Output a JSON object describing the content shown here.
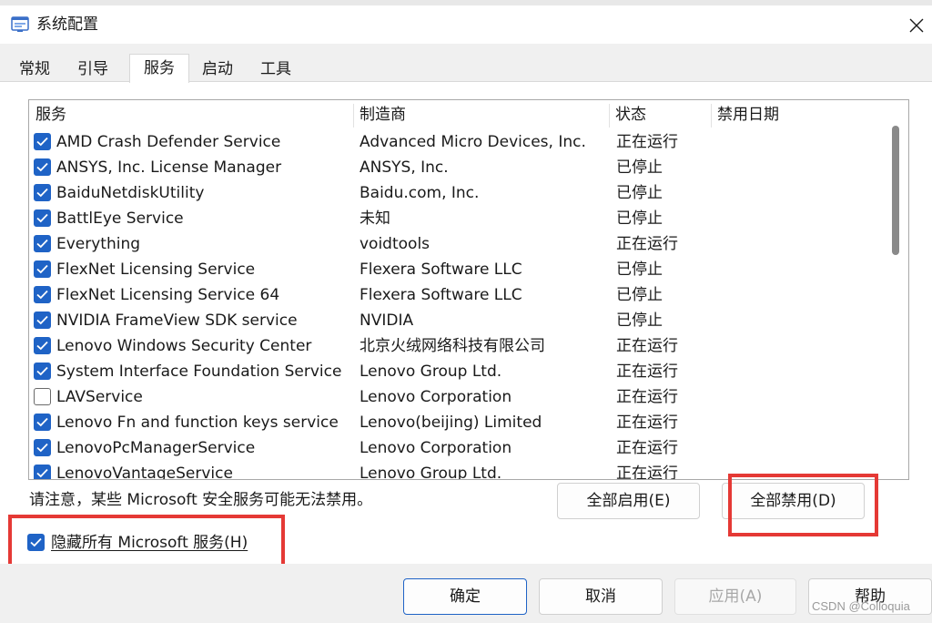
{
  "window": {
    "title": "系统配置"
  },
  "tabs": [
    {
      "label": "常规"
    },
    {
      "label": "引导"
    },
    {
      "label": "服务"
    },
    {
      "label": "启动"
    },
    {
      "label": "工具"
    }
  ],
  "table": {
    "columns": [
      "服务",
      "制造商",
      "状态",
      "禁用日期"
    ],
    "rows": [
      {
        "checked": true,
        "service": "AMD Crash Defender Service",
        "manufacturer": "Advanced Micro Devices, Inc.",
        "status": "正在运行"
      },
      {
        "checked": true,
        "service": "ANSYS, Inc. License Manager",
        "manufacturer": "ANSYS, Inc.",
        "status": "已停止"
      },
      {
        "checked": true,
        "service": "BaiduNetdiskUtility",
        "manufacturer": "Baidu.com, Inc.",
        "status": "已停止"
      },
      {
        "checked": true,
        "service": "BattlEye Service",
        "manufacturer": "未知",
        "status": "已停止"
      },
      {
        "checked": true,
        "service": "Everything",
        "manufacturer": "voidtools",
        "status": "正在运行"
      },
      {
        "checked": true,
        "service": "FlexNet Licensing Service",
        "manufacturer": "Flexera Software LLC",
        "status": "已停止"
      },
      {
        "checked": true,
        "service": "FlexNet Licensing Service 64",
        "manufacturer": "Flexera Software LLC",
        "status": "已停止"
      },
      {
        "checked": true,
        "service": "NVIDIA FrameView SDK service",
        "manufacturer": "NVIDIA",
        "status": "已停止"
      },
      {
        "checked": true,
        "service": "Lenovo Windows Security Center",
        "manufacturer": "北京火绒网络科技有限公司",
        "status": "正在运行"
      },
      {
        "checked": true,
        "service": "System Interface Foundation Service",
        "manufacturer": "Lenovo Group Ltd.",
        "status": "正在运行"
      },
      {
        "checked": false,
        "service": "LAVService",
        "manufacturer": "Lenovo Corporation",
        "status": "正在运行"
      },
      {
        "checked": true,
        "service": "Lenovo Fn and function keys service",
        "manufacturer": "Lenovo(beijing) Limited",
        "status": "正在运行"
      },
      {
        "checked": true,
        "service": "LenovoPcManagerService",
        "manufacturer": "Lenovo Corporation",
        "status": "正在运行"
      },
      {
        "checked": true,
        "service": "LenovoVantageService",
        "manufacturer": "Lenovo Group Ltd.",
        "status": "正在运行"
      }
    ]
  },
  "note": "请注意，某些 Microsoft 安全服务可能无法禁用。",
  "buttons": {
    "enable_all": "全部启用(E)",
    "disable_all": "全部禁用(D)",
    "ok": "确定",
    "cancel": "取消",
    "apply": "应用(A)",
    "help": "帮助"
  },
  "hide_ms": {
    "label": "隐藏所有 Microsoft 服务(H)",
    "checked": true
  },
  "watermark": "CSDN @Colloquia",
  "colors": {
    "accent": "#1f63c6",
    "highlight": "#e53935"
  }
}
